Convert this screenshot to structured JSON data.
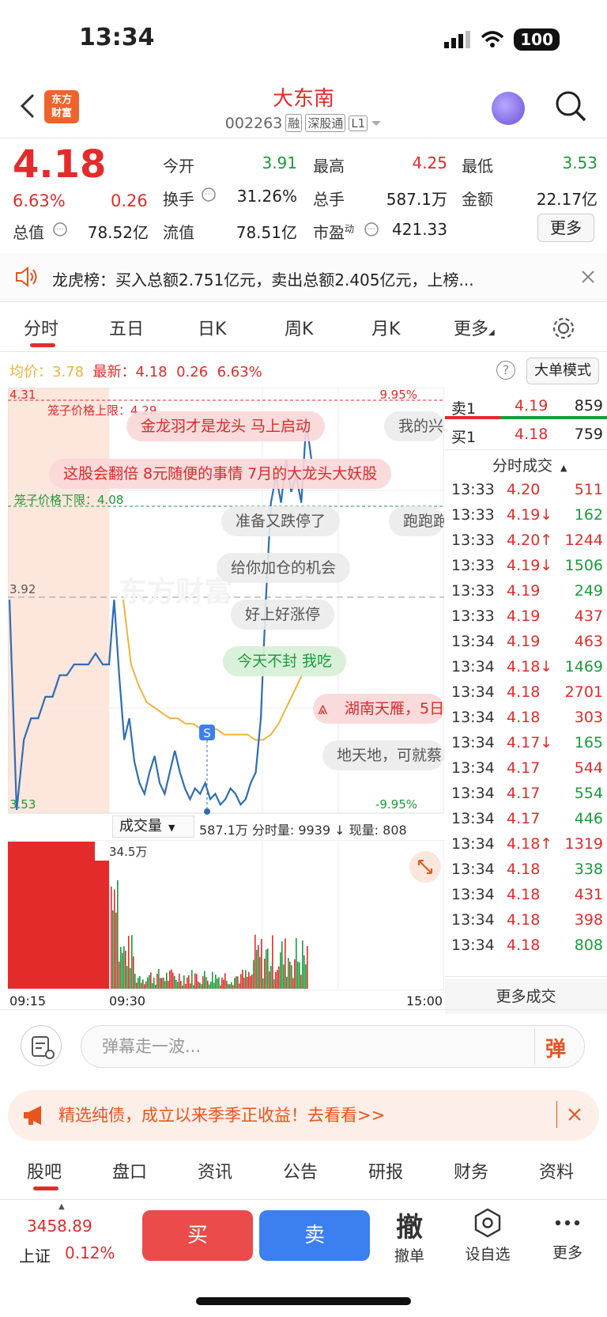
{
  "status": {
    "time": "13:34",
    "battery": "100"
  },
  "header": {
    "name": "大东南",
    "code": "002263",
    "tags": [
      "融",
      "深股通",
      "L1"
    ],
    "logo_lines": [
      "东方",
      "财富"
    ]
  },
  "quote": {
    "price": "4.18",
    "pct": "6.63%",
    "chg": "0.26",
    "open_label": "今开",
    "open": "3.91",
    "high_label": "最高",
    "high": "4.25",
    "low_label": "最低",
    "low": "3.53",
    "turnover_label": "换手",
    "turnover": "31.26%",
    "volume_label": "总手",
    "volume": "587.1万",
    "amount_label": "金额",
    "amount": "22.17亿",
    "mcap_label": "总值",
    "mcap": "78.52亿",
    "float_label": "流值",
    "float": "78.51亿",
    "pe_label": "市盈",
    "pe_sup": "动",
    "pe": "421.33",
    "more": "更多"
  },
  "longhu": {
    "text": "龙虎榜：买入总额2.751亿元，卖出总额2.405亿元，上榜..."
  },
  "tabs": [
    "分时",
    "五日",
    "日K",
    "周K",
    "月K",
    "更多"
  ],
  "chart_head": {
    "avg_label": "均价：",
    "avg": "3.78",
    "latest_label": "最新：",
    "latest": "4.18",
    "chg": "0.26",
    "pct": "6.63%",
    "mode": "大单模式"
  },
  "chart_labels": {
    "top_price": "4.31",
    "top_pct": "9.95%",
    "prev_close": "3.92",
    "bottom_price": "3.53",
    "bottom_pct": "-9.95%",
    "upper_limit": "笼子价格上限：4.29",
    "lower_limit": "笼子价格下限：4.08",
    "vol_selector": "成交量",
    "vol_info": "587.1万 分时量: 9939 ↓ 现量: 808",
    "vol_max": "34.5万",
    "t_start": "09:15",
    "t_open": "09:30",
    "t_end": "15:00",
    "watermark": "东方财富"
  },
  "danmu": [
    "金龙羽才是龙头 马上启动",
    "我的兴",
    "这股会翻倍 8元随便的事情 7月的大龙头大妖股",
    "准备又跌停了",
    "跑跑跑",
    "给你加仓的机会",
    "好上好涨停",
    "今天不封 我吃",
    "湖南天雁，5日",
    "地天地，可就蔡"
  ],
  "chart_data": {
    "type": "line",
    "title": "",
    "xlabel": "",
    "ylabel": "",
    "ylim": [
      3.53,
      4.31
    ],
    "prev_close": 3.92,
    "x_ticks": [
      "09:15",
      "09:30",
      "15:00"
    ],
    "series": [],
    "price_line": [
      3.92,
      3.53,
      3.66,
      3.7,
      3.7,
      3.74,
      3.74,
      3.78,
      3.78,
      3.8,
      3.8,
      3.8,
      3.82,
      3.8,
      3.92,
      3.78,
      3.66,
      3.7,
      3.62,
      3.58,
      3.56,
      3.6,
      3.63,
      3.58,
      3.56,
      3.6,
      3.64,
      3.6,
      3.57,
      3.55,
      3.57,
      3.56,
      3.58,
      3.55,
      3.56,
      3.54,
      3.55,
      3.57,
      3.56,
      3.54,
      3.55,
      3.58,
      3.6,
      3.7,
      3.92,
      4.1,
      4.15,
      4.1,
      4.18,
      4.12,
      4.15,
      4.1,
      4.25,
      4.18
    ],
    "avg_line": [
      3.92,
      3.8,
      3.76,
      3.73,
      3.72,
      3.71,
      3.7,
      3.7,
      3.69,
      3.69,
      3.68,
      3.68,
      3.68,
      3.67,
      3.67,
      3.67,
      3.67,
      3.66,
      3.66,
      3.67,
      3.69,
      3.72,
      3.75,
      3.78
    ]
  },
  "order_book": {
    "sell1_label": "卖1",
    "sell1_price": "4.19",
    "sell1_vol": "859",
    "buy1_label": "买1",
    "buy1_price": "4.18",
    "buy1_vol": "759",
    "title": "分时成交",
    "trades": [
      {
        "t": "13:33",
        "p": "4.20",
        "a": "",
        "v": "511",
        "c": "red"
      },
      {
        "t": "13:33",
        "p": "4.19",
        "a": "↓",
        "v": "162",
        "c": "green"
      },
      {
        "t": "13:33",
        "p": "4.20",
        "a": "↑",
        "v": "1244",
        "c": "red"
      },
      {
        "t": "13:33",
        "p": "4.19",
        "a": "↓",
        "v": "1506",
        "c": "green"
      },
      {
        "t": "13:33",
        "p": "4.19",
        "a": "",
        "v": "249",
        "c": "green"
      },
      {
        "t": "13:33",
        "p": "4.19",
        "a": "",
        "v": "437",
        "c": "red"
      },
      {
        "t": "13:34",
        "p": "4.19",
        "a": "",
        "v": "463",
        "c": "red"
      },
      {
        "t": "13:34",
        "p": "4.18",
        "a": "↓",
        "v": "1469",
        "c": "green"
      },
      {
        "t": "13:34",
        "p": "4.18",
        "a": "",
        "v": "2701",
        "c": "red"
      },
      {
        "t": "13:34",
        "p": "4.18",
        "a": "",
        "v": "303",
        "c": "red"
      },
      {
        "t": "13:34",
        "p": "4.17",
        "a": "↓",
        "v": "165",
        "c": "green"
      },
      {
        "t": "13:34",
        "p": "4.17",
        "a": "",
        "v": "544",
        "c": "red"
      },
      {
        "t": "13:34",
        "p": "4.17",
        "a": "",
        "v": "554",
        "c": "green"
      },
      {
        "t": "13:34",
        "p": "4.17",
        "a": "",
        "v": "446",
        "c": "green"
      },
      {
        "t": "13:34",
        "p": "4.18",
        "a": "↑",
        "v": "1319",
        "c": "red"
      },
      {
        "t": "13:34",
        "p": "4.18",
        "a": "",
        "v": "338",
        "c": "green"
      },
      {
        "t": "13:34",
        "p": "4.18",
        "a": "",
        "v": "431",
        "c": "red"
      },
      {
        "t": "13:34",
        "p": "4.18",
        "a": "",
        "v": "398",
        "c": "red"
      },
      {
        "t": "13:34",
        "p": "4.18",
        "a": "",
        "v": "808",
        "c": "green"
      }
    ],
    "more": "更多成交"
  },
  "input": {
    "placeholder": "弹幕走一波...",
    "send": "弹"
  },
  "ad": {
    "text": "精选纯债，成立以来季季正收益！去看看>>"
  },
  "bottom_tabs": [
    "股吧",
    "盘口",
    "资讯",
    "公告",
    "研报",
    "财务",
    "资料"
  ],
  "bottom_bar": {
    "index_value": "3458.89",
    "index_name": "上证",
    "index_pct": "0.12%",
    "buy": "买",
    "sell": "卖",
    "cancel_glyph": "撤",
    "cancel": "撤单",
    "watch": "设自选",
    "more": "更多"
  },
  "colors": {
    "up": "#e32b2b",
    "down": "#1a9b3a",
    "price_line": "#2f6db5",
    "avg_line": "#f0b43c"
  }
}
